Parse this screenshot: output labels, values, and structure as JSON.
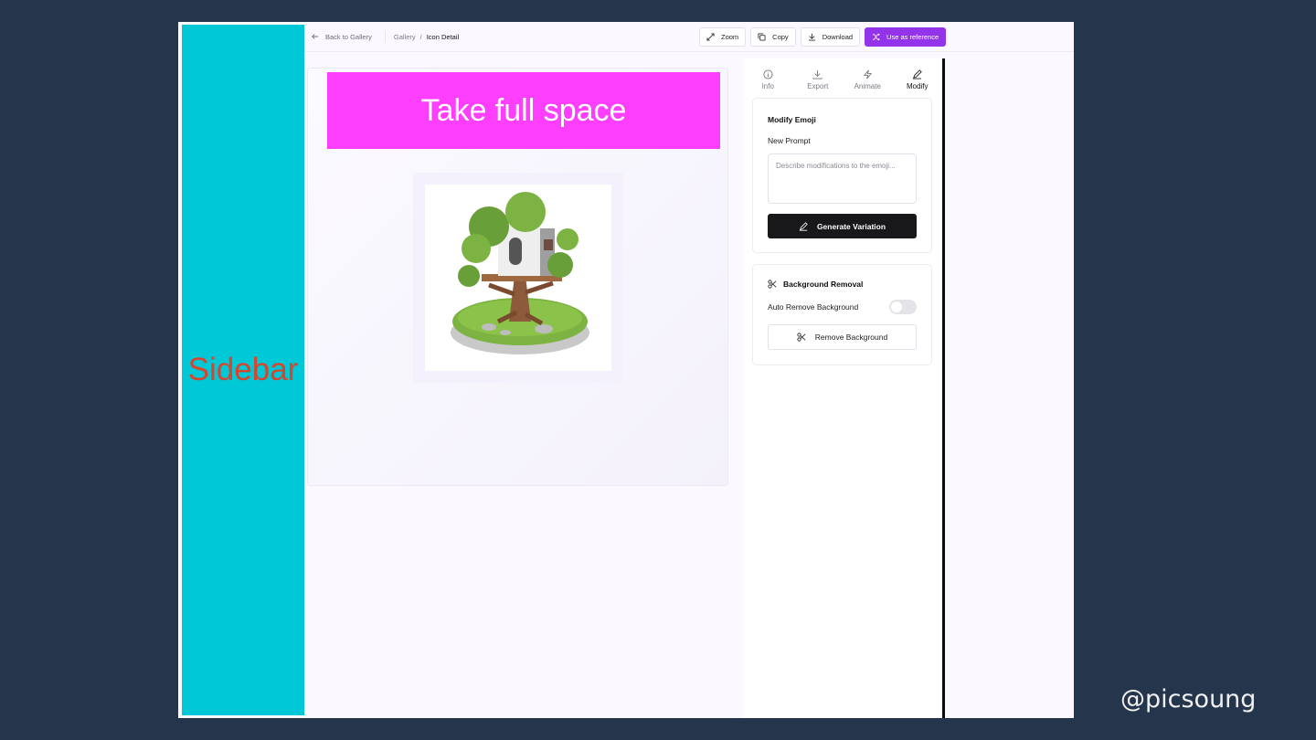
{
  "sidebar": {
    "label": "Sidebar"
  },
  "topbar": {
    "back_label": "Back to Gallery",
    "breadcrumb": {
      "parent": "Gallery",
      "separator": "/",
      "current": "Icon Detail"
    },
    "actions": {
      "zoom": "Zoom",
      "copy": "Copy",
      "download": "Download",
      "use_reference": "Use as reference"
    }
  },
  "canvas": {
    "banner_text": "Take full space"
  },
  "panel": {
    "tabs": [
      {
        "label": "Info",
        "icon": "info-icon"
      },
      {
        "label": "Export",
        "icon": "download-icon"
      },
      {
        "label": "Animate",
        "icon": "lightning-icon"
      },
      {
        "label": "Modify",
        "icon": "pencil-icon"
      }
    ],
    "modify": {
      "title": "Modify Emoji",
      "prompt_label": "New Prompt",
      "prompt_placeholder": "Describe modifications to the emoji...",
      "generate_label": "Generate Variation"
    },
    "background": {
      "title": "Background Removal",
      "auto_label": "Auto Remove Background",
      "auto_enabled": false,
      "remove_label": "Remove Background"
    }
  },
  "colors": {
    "sidebar": "#00c8d6",
    "banner": "#fd3ffd",
    "primary": "#9333ea",
    "sidebar_text": "#d9442a"
  },
  "watermark": "@picsoung"
}
